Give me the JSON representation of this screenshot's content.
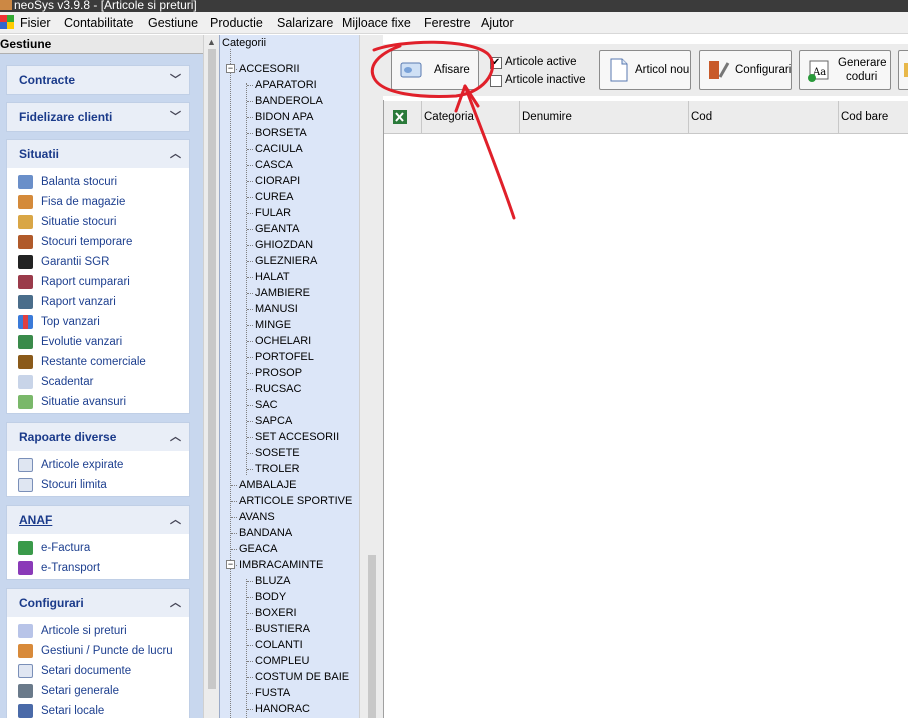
{
  "window": {
    "title": "neoSys v3.9.8 - [Articole si preturi]"
  },
  "menu": [
    "Fisier",
    "Contabilitate",
    "Gestiune",
    "Productie",
    "Salarizare",
    "Mijloace fixe",
    "Ferestre",
    "Ajutor"
  ],
  "sidebar": {
    "header": "Gestiune",
    "groups": [
      {
        "title": "Contracte",
        "chevron": "chevron-down-icon",
        "items": []
      },
      {
        "title": "Fidelizare clienti",
        "chevron": "chevron-down-icon",
        "items": []
      },
      {
        "title": "Situatii",
        "chevron": "chevron-up-icon",
        "items": [
          "Balanta stocuri",
          "Fisa de magazie",
          "Situatie stocuri",
          "Stocuri temporare",
          "Garantii SGR",
          "Raport cumparari",
          "Raport vanzari",
          "Top vanzari",
          "Evolutie vanzari",
          "Restante comerciale",
          "Scadentar",
          "Situatie avansuri"
        ]
      },
      {
        "title": "Rapoarte diverse",
        "chevron": "chevron-up-icon",
        "items": [
          "Articole expirate",
          "Stocuri limita"
        ]
      },
      {
        "title": "ANAF",
        "chevron": "chevron-up-icon",
        "items": [
          "e-Factura",
          "e-Transport"
        ]
      },
      {
        "title": "Configurari",
        "chevron": "chevron-up-icon",
        "items": [
          "Articole si preturi",
          "Gestiuni / Puncte de lucru",
          "Setari documente",
          "Setari generale",
          "Setari locale"
        ]
      }
    ]
  },
  "tree": {
    "header": "Categorii",
    "root1": "ACCESORII",
    "root1_children": [
      "APARATORI",
      "BANDEROLA",
      "BIDON APA",
      "BORSETA",
      "CACIULA",
      "CASCA",
      "CIORAPI",
      "CUREA",
      "FULAR",
      "GEANTA",
      "GHIOZDAN",
      "GLEZNIERA",
      "HALAT",
      "JAMBIERE",
      "MANUSI",
      "MINGE",
      "OCHELARI",
      "PORTOFEL",
      "PROSOP",
      "RUCSAC",
      "SAC",
      "SAPCA",
      "SET ACCESORII",
      "SOSETE",
      "TROLER"
    ],
    "roots_mid": [
      "AMBALAJE",
      "ARTICOLE SPORTIVE",
      "AVANS",
      "BANDANA",
      "GEACA"
    ],
    "root2": "IMBRACAMINTE",
    "root2_children": [
      "BLUZA",
      "BODY",
      "BOXERI",
      "BUSTIERA",
      "COLANTI",
      "COMPLEU",
      "COSTUM DE BAIE",
      "FUSTA",
      "HANORAC"
    ]
  },
  "toolbar": {
    "afisare": "Afisare",
    "active": "Articole active",
    "inactive": "Articole inactive",
    "nou": "Articol nou",
    "configurari": "Configurari",
    "generare1": "Generare",
    "generare2": "coduri"
  },
  "grid": {
    "columns": [
      "Categoria",
      "Denumire",
      "Cod",
      "Cod bare"
    ]
  },
  "colors": {
    "sidebar_bg": "#c8d7ee",
    "link": "#1d3f8f",
    "annotation": "#e0202a"
  }
}
